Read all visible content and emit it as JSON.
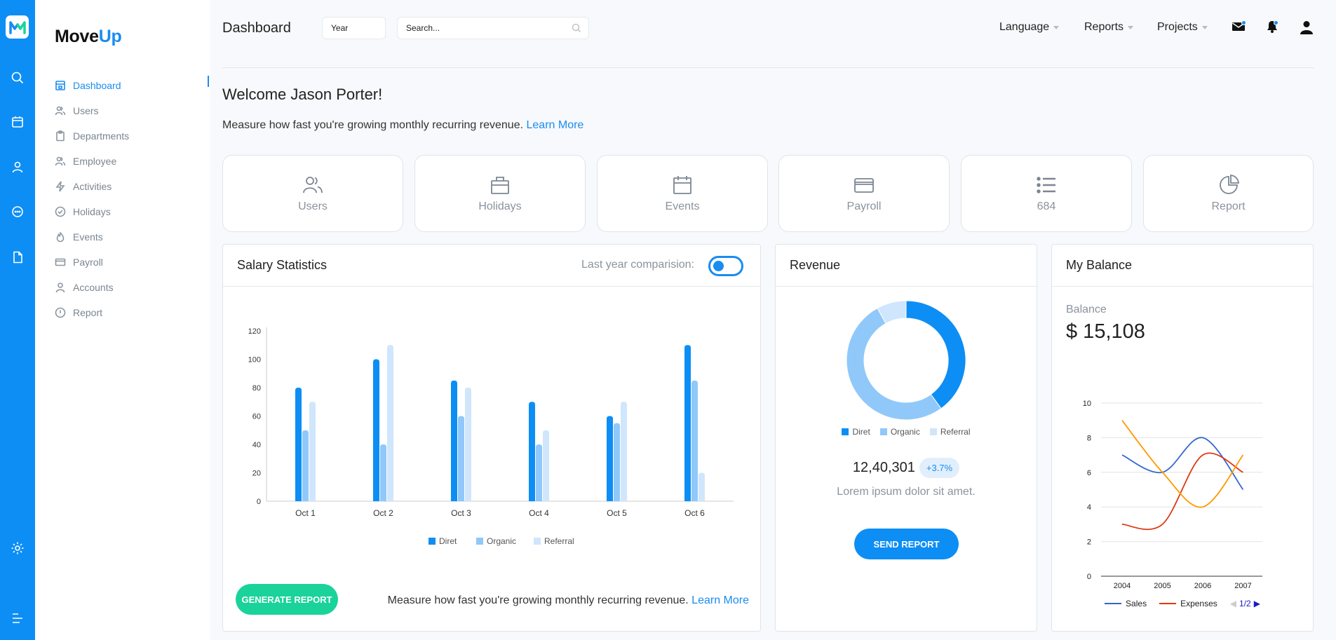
{
  "brand": {
    "part1": "Move",
    "part2": "Up"
  },
  "rail_icons": [
    "search-icon",
    "calendar-icon",
    "user-icon",
    "chat-icon",
    "file-icon",
    "settings-icon",
    "menu-icon"
  ],
  "sidebar": {
    "items": [
      {
        "label": "Dashboard",
        "icon": "dashboard-icon",
        "active": true
      },
      {
        "label": "Users",
        "icon": "users-icon"
      },
      {
        "label": "Departments",
        "icon": "clipboard-icon"
      },
      {
        "label": "Employee",
        "icon": "users-icon"
      },
      {
        "label": "Activities",
        "icon": "lightning-icon"
      },
      {
        "label": "Holidays",
        "icon": "check-circle-icon"
      },
      {
        "label": "Events",
        "icon": "flame-icon"
      },
      {
        "label": "Payroll",
        "icon": "card-icon"
      },
      {
        "label": "Accounts",
        "icon": "user-icon"
      },
      {
        "label": "Report",
        "icon": "info-icon"
      }
    ]
  },
  "header": {
    "title": "Dashboard",
    "year_label": "Year",
    "search_placeholder": "Search...",
    "menus": [
      "Language",
      "Reports",
      "Projects"
    ]
  },
  "welcome": {
    "title": "Welcome Jason Porter!",
    "subtitle": "Measure how fast you're growing monthly recurring revenue.",
    "link": "Learn More"
  },
  "tiles": [
    {
      "label": "Users",
      "icon": "users-icon"
    },
    {
      "label": "Holidays",
      "icon": "bag-icon"
    },
    {
      "label": "Events",
      "icon": "calendar-icon"
    },
    {
      "label": "Payroll",
      "icon": "card-icon"
    },
    {
      "label": "684",
      "icon": "list-icon"
    },
    {
      "label": "Report",
      "icon": "pie-icon"
    }
  ],
  "salary": {
    "title": "Salary Statistics",
    "toggle_label": "Last year comparision:",
    "button": "GENERATE REPORT",
    "footer_text": "Measure how fast you're growing monthly recurring revenue.",
    "footer_link": "Learn More"
  },
  "revenue": {
    "title": "Revenue",
    "value": "12,40,301",
    "badge": "+3.7%",
    "caption": "Lorem ipsum dolor sit amet.",
    "button": "SEND REPORT"
  },
  "balance": {
    "title": "My Balance",
    "label": "Balance",
    "value": "$ 15,108",
    "pager": "1/2"
  },
  "colors": {
    "primary": "#0d8ef5",
    "organic": "#90c8fa",
    "referral": "#cfe6fc",
    "green": "#19d39a",
    "sales": "#3366cc",
    "expenses": "#dc3912",
    "orange": "#ff9900"
  },
  "chart_data": [
    {
      "type": "bar",
      "categories": [
        "Oct 1",
        "Oct 2",
        "Oct 3",
        "Oct 4",
        "Oct 5",
        "Oct 6"
      ],
      "series": [
        {
          "name": "Diret",
          "values": [
            80,
            100,
            85,
            70,
            60,
            110
          ]
        },
        {
          "name": "Organic",
          "values": [
            50,
            40,
            60,
            40,
            55,
            85
          ]
        },
        {
          "name": "Referral",
          "values": [
            70,
            110,
            80,
            50,
            70,
            20
          ]
        }
      ],
      "ylim": [
        0,
        120
      ],
      "yticks": [
        0,
        20,
        40,
        60,
        80,
        100,
        120
      ],
      "legend": "bottom"
    },
    {
      "type": "pie",
      "labels": [
        "Diret",
        "Organic",
        "Referral"
      ],
      "values": [
        40,
        52,
        8
      ],
      "legend": "bottom"
    },
    {
      "type": "line",
      "x": [
        "2004",
        "2005",
        "2006",
        "2007"
      ],
      "series": [
        {
          "name": "Sales",
          "values": [
            7,
            6,
            8,
            5
          ]
        },
        {
          "name": "Expenses",
          "values": [
            3,
            3,
            7,
            6
          ]
        },
        {
          "name": "",
          "values": [
            9,
            6,
            4,
            7
          ]
        }
      ],
      "ylim": [
        0,
        10
      ],
      "yticks": [
        0,
        2,
        4,
        6,
        8,
        10
      ],
      "legend": "bottom"
    }
  ]
}
